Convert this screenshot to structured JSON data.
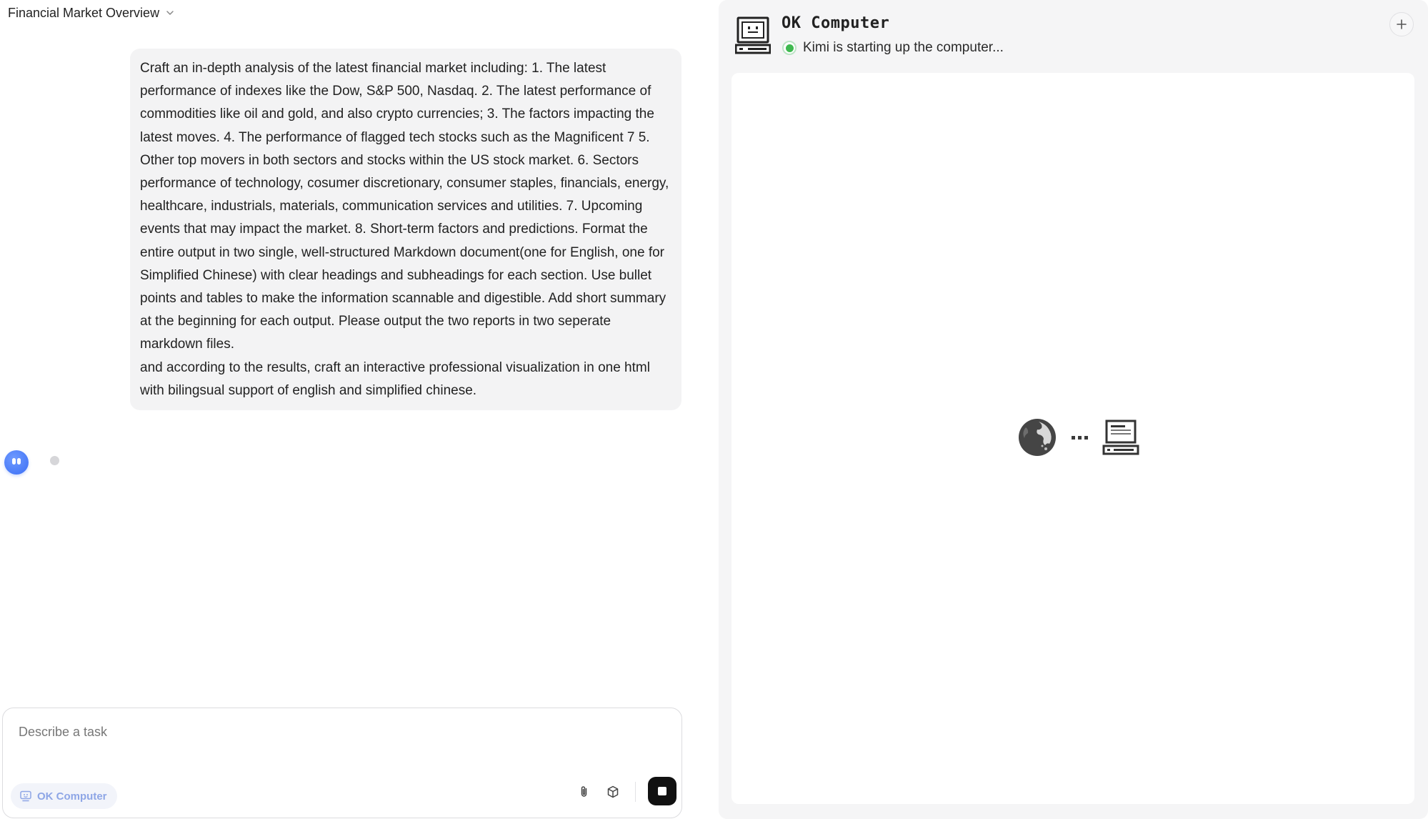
{
  "conversation": {
    "title": "Financial Market Overview",
    "title_icon": "chevron-down-icon",
    "user_message_paragraphs": [
      "Craft an in-depth analysis of the latest financial market including: 1. The latest performance of indexes like the Dow, S&P 500, Nasdaq. 2. The latest performance of commodities like oil and gold, and also crypto currencies; 3. The factors impacting the latest moves. 4. The performance of flagged tech stocks such as the Magnificent 7 5. Other top movers in both sectors and stocks within the US stock market. 6. Sectors performance of technology, cosumer discretionary, consumer staples, financials, energy, healthcare, industrials, materials, communication services and utilities. 7. Upcoming events that may impact the market. 8. Short-term factors and predictions. Format the entire output in two single, well-structured Markdown document(one for English, one for Simplified Chinese) with clear headings and subheadings for each section. Use bullet points and tables to make the information scannable and digestible. Add short summary at the beginning for each output. Please output the two reports in two seperate markdown files.",
      "and according to the results, craft an interactive professional visualization in one html with bilingsual support of english and simplified chinese."
    ],
    "assistant_avatar_icon": "kimi-avatar-icon",
    "assistant_state": "typing"
  },
  "composer": {
    "placeholder": "Describe a task",
    "value": "",
    "mode_chip_label": "OK Computer",
    "mode_chip_icon": "computer-icon",
    "attach_icon": "paperclip-icon",
    "cube_icon": "cube-icon",
    "stop_icon": "stop-icon"
  },
  "computer_panel": {
    "title": "OK Computer",
    "logo_icon": "retro-computer-icon",
    "status_text": "Kimi is starting up the computer...",
    "status_color": "#3fb950",
    "new_icon": "plus-icon",
    "boot_icons": [
      "globe-icon",
      "ellipsis-icon",
      "pc-icon"
    ]
  }
}
